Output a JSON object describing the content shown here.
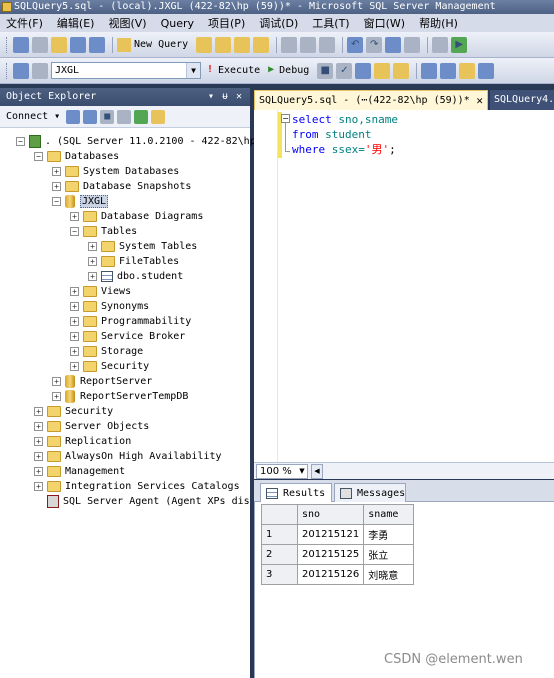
{
  "window": {
    "title": "SQLQuery5.sql - (local).JXGL (422-82\\hp (59))* - Microsoft SQL Server Management"
  },
  "menu": [
    "文件(F)",
    "编辑(E)",
    "视图(V)",
    "Query",
    "项目(P)",
    "调试(D)",
    "工具(T)",
    "窗口(W)",
    "帮助(H)"
  ],
  "toolbar1": {
    "new_query": "New Query"
  },
  "toolbar2": {
    "database": "JXGL",
    "execute": "Execute",
    "debug": "Debug"
  },
  "object_explorer": {
    "title": "Object Explorer",
    "connect": "Connect",
    "tree": {
      "server": ". (SQL Server 11.0.2100 - 422-82\\hp",
      "databases": "Databases",
      "system_databases": "System Databases",
      "database_snapshots": "Database Snapshots",
      "jxgl": "JXGL",
      "database_diagrams": "Database Diagrams",
      "tables": "Tables",
      "system_tables": "System Tables",
      "file_tables": "FileTables",
      "dbo_student": "dbo.student",
      "views": "Views",
      "synonyms": "Synonyms",
      "programmability": "Programmability",
      "service_broker": "Service Broker",
      "storage": "Storage",
      "security_db": "Security",
      "report_server": "ReportServer",
      "report_server_temp": "ReportServerTempDB",
      "security": "Security",
      "server_objects": "Server Objects",
      "replication": "Replication",
      "alwayson": "AlwaysOn High Availability",
      "management": "Management",
      "integration": "Integration Services Catalogs",
      "agent": "SQL Server Agent (Agent XPs dis"
    }
  },
  "tabs": {
    "active": "SQLQuery5.sql - (⋯(422-82\\hp (59))*",
    "inactive": "SQLQuery4.s"
  },
  "query": {
    "line1_kw": "select",
    "line1_rest": " sno,sname",
    "line2_kw": "from",
    "line2_rest": " student",
    "line3_kw": "where",
    "line3_id": " ssex=",
    "line3_str": "'男'",
    "line3_end": ";"
  },
  "zoom": "100 %",
  "results_tabs": {
    "results": "Results",
    "messages": "Messages"
  },
  "results": {
    "columns": [
      "sno",
      "sname"
    ],
    "rows": [
      {
        "n": "1",
        "sno": "201215121",
        "sname": "李勇"
      },
      {
        "n": "2",
        "sno": "201215125",
        "sname": "张立"
      },
      {
        "n": "3",
        "sno": "201215126",
        "sname": "刘晓意"
      }
    ]
  },
  "watermark": "CSDN @element.wen"
}
